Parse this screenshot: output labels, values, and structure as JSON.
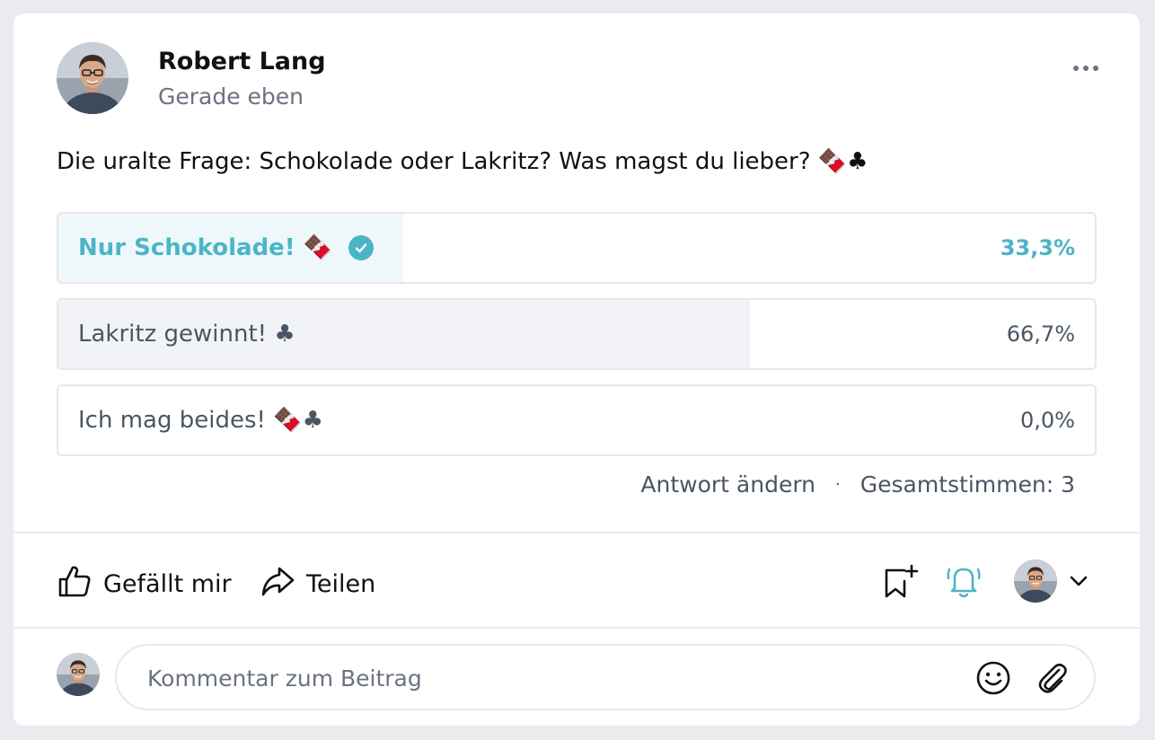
{
  "post": {
    "author": "Robert Lang",
    "time": "Gerade eben",
    "text": "Die uralte Frage: Schokolade oder Lakritz? Was magst du lieber? 🍫♣"
  },
  "poll": {
    "options": [
      {
        "label": "Nur Schokolade! 🍫",
        "percent": "33,3%",
        "fraction": 0.333,
        "selected": true
      },
      {
        "label": "Lakritz gewinnt! ♣",
        "percent": "66,7%",
        "fraction": 0.667,
        "selected": false
      },
      {
        "label": "Ich mag beides! 🍫♣",
        "percent": "0,0%",
        "fraction": 0.0,
        "selected": false
      }
    ],
    "change_answer": "Antwort ändern",
    "separator": "·",
    "total_votes": "Gesamtstimmen: 3"
  },
  "actions": {
    "like": "Gefällt mir",
    "share": "Teilen"
  },
  "comment": {
    "placeholder": "Kommentar zum Beitrag"
  },
  "icons": {
    "more": "more-icon",
    "like": "thumbs-up-icon",
    "share": "share-icon",
    "bookmark": "bookmark-add-icon",
    "bell": "bell-icon",
    "chevron": "chevron-down-icon",
    "emoji": "smiley-icon",
    "attach": "paperclip-icon",
    "check": "check-circle-icon"
  },
  "colors": {
    "accent": "#4bb5c6",
    "selected_fill": "#eef8fb",
    "bar_fill": "#f2f3f6",
    "text_muted": "#6b7280"
  }
}
